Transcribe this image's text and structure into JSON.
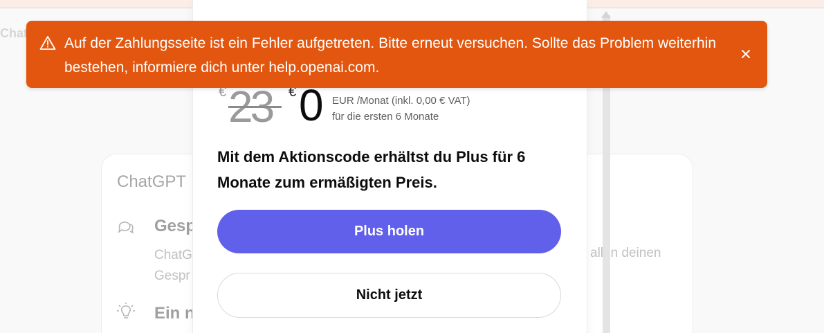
{
  "background": {
    "partial_app_name": "Chat",
    "card": {
      "title": "ChatGPT",
      "features": [
        {
          "icon": "chat-bubbles-icon",
          "title": "Gesp",
          "desc_line1": "ChatG",
          "desc_line2": "Gespr"
        },
        {
          "icon": "lightbulb-icon",
          "title": "Ein n"
        }
      ],
      "desc_right": "allen deinen"
    }
  },
  "modal": {
    "old_currency": "€",
    "old_price": "23",
    "new_currency": "€",
    "new_price": "0",
    "price_detail_line1": "EUR /Monat (inkl. 0,00 € VAT)",
    "price_detail_line2": "für die ersten 6 Monate",
    "promo_text": "Mit dem Aktionscode erhältst du Plus für 6 Monate zum ermäßigten Preis.",
    "primary_button": "Plus holen",
    "secondary_button": "Nicht jetzt"
  },
  "toast": {
    "icon": "warning-triangle-icon",
    "message": "Auf der Zahlungsseite ist ein Fehler aufgetreten. Bitte erneut versuchen. Sollte das Problem weiterhin bestehen, informiere dich unter help.openai.com.",
    "close_icon": "close-icon"
  },
  "colors": {
    "toast_bg": "#e2560f",
    "primary_button_bg": "#6160ea"
  }
}
